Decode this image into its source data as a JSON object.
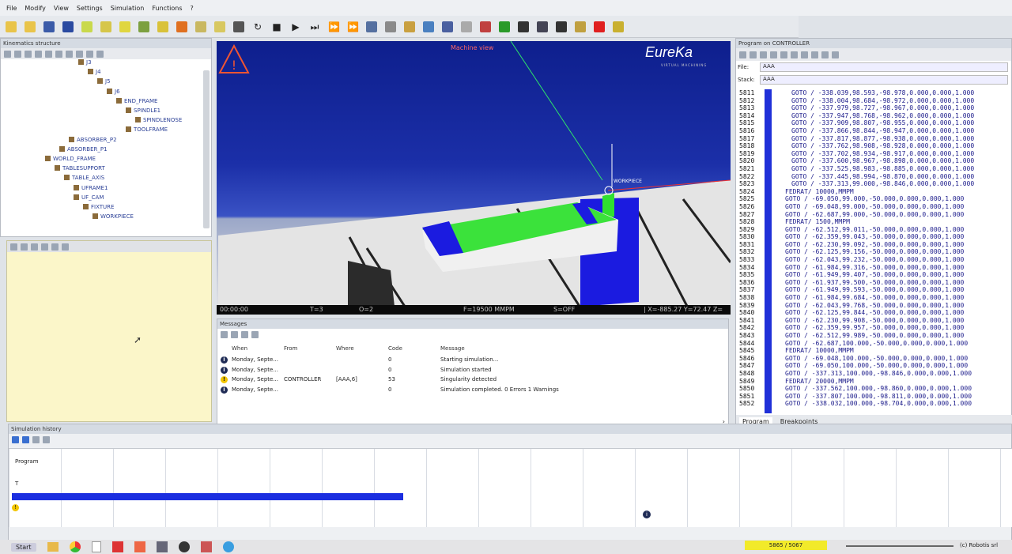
{
  "menu": [
    "File",
    "Modify",
    "View",
    "Settings",
    "Simulation",
    "Functions",
    "?"
  ],
  "toolbar_icons": [
    "new-doc-icon",
    "open-folder-icon",
    "save-icon",
    "machine-view-icon",
    "zoom-icon",
    "measure-icon",
    "cube-icon",
    "axes-icon",
    "calc-icon",
    "pencil-icon",
    "table-icon",
    "clipboard-icon",
    "tools-icon",
    "reset-icon",
    "stop-icon",
    "play-icon",
    "step-icon",
    "fast-forward-icon",
    "fast-forward-2-icon",
    "list-icon",
    "cpu-icon",
    "doc-icon",
    "monitor-icon",
    "network-icon",
    "cube-3d-icon",
    "cut-icon",
    "move-icon",
    "film-icon",
    "gauge-icon",
    "camera-icon",
    "file-check-icon",
    "palette-icon",
    "triangle-icon"
  ],
  "kinematics": {
    "title": "Kinematics structure",
    "tree": [
      "J3",
      "J4",
      "J5",
      "J6",
      "END_FRAME",
      "SPINDLE1",
      "SPINDLENOSE",
      "TOOLFRAME",
      "ABSORBER_P2",
      "ABSORBER_P1",
      "WORLD_FRAME",
      "TABLESUPPORT",
      "TABLE_AXIS",
      "UFRAME1",
      "UF_CAM",
      "FIXTURE",
      "WORKPIECE"
    ]
  },
  "viewport": {
    "label": "Machine view",
    "brand": "EureKa",
    "brand_sub": "VIRTUAL MACHINING",
    "workpiece_label": "WORKPIECE",
    "status": {
      "time": "00:00:00",
      "tool": "T=3",
      "origin": "O=2",
      "feed": "F=19500 MMPM",
      "spindle": "S=OFF",
      "coords": "| X=-885.27 Y=72.47 Z="
    }
  },
  "messages": {
    "title": "Messages",
    "headers": {
      "when": "When",
      "from": "From",
      "where": "Where",
      "code": "Code",
      "message": "Message"
    },
    "rows": [
      {
        "icon": "info",
        "when": "Monday, Septe...",
        "from": "",
        "where": "",
        "code": "0",
        "message": "Starting simulation..."
      },
      {
        "icon": "info",
        "when": "Monday, Septe...",
        "from": "",
        "where": "",
        "code": "0",
        "message": "Simulation started"
      },
      {
        "icon": "warning",
        "when": "Monday, Septe...",
        "from": "CONTROLLER",
        "where": "[AAA,6]",
        "code": "53",
        "message": "Singularity detected"
      },
      {
        "icon": "info",
        "when": "Monday, Septe...",
        "from": "",
        "where": "",
        "code": "0",
        "message": "Simulation completed. 0 Errors 1 Warnings"
      }
    ]
  },
  "program": {
    "title": "Program on CONTROLLER",
    "file_label": "File:",
    "file_value": "AAA",
    "stack_label": "Stack:",
    "stack_value": "AAA",
    "tabs": [
      "Program",
      "Breakpoints"
    ],
    "lines": [
      {
        "n": "5811",
        "t": "GOTO  / -338.039,98.593,-98.978,0.000,0.000,1.000",
        "i": 1
      },
      {
        "n": "5812",
        "t": "GOTO  / -338.004,98.684,-98.972,0.000,0.000,1.000",
        "i": 1
      },
      {
        "n": "5813",
        "t": "GOTO  / -337.979,98.727,-98.967,0.000,0.000,1.000",
        "i": 1
      },
      {
        "n": "5814",
        "t": "GOTO  / -337.947,98.768,-98.962,0.000,0.000,1.000",
        "i": 1
      },
      {
        "n": "5815",
        "t": "GOTO  / -337.909,98.807,-98.955,0.000,0.000,1.000",
        "i": 1
      },
      {
        "n": "5816",
        "t": "GOTO  / -337.866,98.844,-98.947,0.000,0.000,1.000",
        "i": 1
      },
      {
        "n": "5817",
        "t": "GOTO  / -337.817,98.877,-98.938,0.000,0.000,1.000",
        "i": 1
      },
      {
        "n": "5818",
        "t": "GOTO  / -337.762,98.908,-98.928,0.000,0.000,1.000",
        "i": 1
      },
      {
        "n": "5819",
        "t": "GOTO  / -337.702,98.934,-98.917,0.000,0.000,1.000",
        "i": 1
      },
      {
        "n": "5820",
        "t": "GOTO  / -337.600,98.967,-98.898,0.000,0.000,1.000",
        "i": 1
      },
      {
        "n": "5821",
        "t": "GOTO  / -337.525,98.983,-98.885,0.000,0.000,1.000",
        "i": 1
      },
      {
        "n": "5822",
        "t": "GOTO  / -337.445,98.994,-98.870,0.000,0.000,1.000",
        "i": 1
      },
      {
        "n": "5823",
        "t": "GOTO  / -337.313,99.000,-98.846,0.000,0.000,1.000",
        "i": 1
      },
      {
        "n": "5824",
        "t": "FEDRAT/ 10000,MMPM",
        "i": 0
      },
      {
        "n": "5825",
        "t": "GOTO  / -69.050,99.000,-50.000,0.000,0.000,1.000",
        "i": 0
      },
      {
        "n": "5826",
        "t": "GOTO  / -69.048,99.000,-50.000,0.000,0.000,1.000",
        "i": 0
      },
      {
        "n": "5827",
        "t": "GOTO  / -62.687,99.000,-50.000,0.000,0.000,1.000",
        "i": 0
      },
      {
        "n": "5828",
        "t": "FEDRAT/ 1500,MMPM",
        "i": 0
      },
      {
        "n": "5829",
        "t": "GOTO  / -62.512,99.011,-50.000,0.000,0.000,1.000",
        "i": 0
      },
      {
        "n": "5830",
        "t": "GOTO  / -62.359,99.043,-50.000,0.000,0.000,1.000",
        "i": 0
      },
      {
        "n": "5831",
        "t": "GOTO  / -62.230,99.092,-50.000,0.000,0.000,1.000",
        "i": 0
      },
      {
        "n": "5832",
        "t": "GOTO  / -62.125,99.156,-50.000,0.000,0.000,1.000",
        "i": 0
      },
      {
        "n": "5833",
        "t": "GOTO  / -62.043,99.232,-50.000,0.000,0.000,1.000",
        "i": 0
      },
      {
        "n": "5834",
        "t": "GOTO  / -61.984,99.316,-50.000,0.000,0.000,1.000",
        "i": 0
      },
      {
        "n": "5835",
        "t": "GOTO  / -61.949,99.407,-50.000,0.000,0.000,1.000",
        "i": 0
      },
      {
        "n": "5836",
        "t": "GOTO  / -61.937,99.500,-50.000,0.000,0.000,1.000",
        "i": 0
      },
      {
        "n": "5837",
        "t": "GOTO  / -61.949,99.593,-50.000,0.000,0.000,1.000",
        "i": 0
      },
      {
        "n": "5838",
        "t": "GOTO  / -61.984,99.684,-50.000,0.000,0.000,1.000",
        "i": 0
      },
      {
        "n": "5839",
        "t": "GOTO  / -62.043,99.768,-50.000,0.000,0.000,1.000",
        "i": 0
      },
      {
        "n": "5840",
        "t": "GOTO  / -62.125,99.844,-50.000,0.000,0.000,1.000",
        "i": 0
      },
      {
        "n": "5841",
        "t": "GOTO  / -62.230,99.908,-50.000,0.000,0.000,1.000",
        "i": 0
      },
      {
        "n": "5842",
        "t": "GOTO  / -62.359,99.957,-50.000,0.000,0.000,1.000",
        "i": 0
      },
      {
        "n": "5843",
        "t": "GOTO  / -62.512,99.989,-50.000,0.000,0.000,1.000",
        "i": 0
      },
      {
        "n": "5844",
        "t": "GOTO  / -62.687,100.000,-50.000,0.000,0.000,1.000",
        "i": 0
      },
      {
        "n": "5845",
        "t": "FEDRAT/ 10000,MMPM",
        "i": 0
      },
      {
        "n": "5846",
        "t": "GOTO  / -69.048,100.000,-50.000,0.000,0.000,1.000",
        "i": 0
      },
      {
        "n": "5847",
        "t": "GOTO  / -69.050,100.000,-50.000,0.000,0.000,1.000",
        "i": 0
      },
      {
        "n": "5848",
        "t": "GOTO  / -337.313,100.000,-98.846,0.000,0.000,1.000",
        "i": 0
      },
      {
        "n": "5849",
        "t": "FEDRAT/ 20000,MMPM",
        "i": 0
      },
      {
        "n": "5850",
        "t": "GOTO  / -337.562,100.000,-98.860,0.000,0.000,1.000",
        "i": 0
      },
      {
        "n": "5851",
        "t": "GOTO  / -337.807,100.000,-98.811,0.000,0.000,1.000",
        "i": 0
      },
      {
        "n": "5852",
        "t": "GOTO  / -338.032,100.000,-98.704,0.000,0.000,1.000",
        "i": 0
      }
    ]
  },
  "history": {
    "title": "Simulation history",
    "rows": [
      "Program",
      "T"
    ],
    "progress_fraction": 0.39
  },
  "taskbar": {
    "start": "Start",
    "status_badge": "5865 / 5067",
    "copyright": "(c) Robotis srl"
  }
}
